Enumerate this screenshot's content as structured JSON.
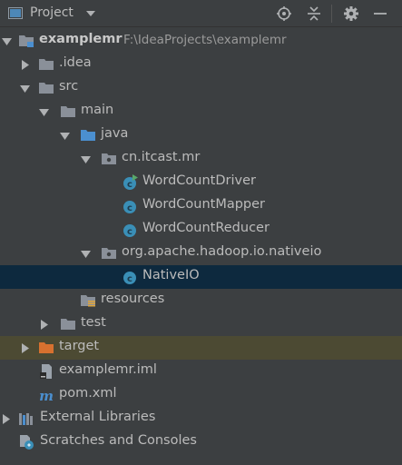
{
  "toolbar": {
    "title": "Project",
    "icons": [
      "project-view-icon",
      "dropdown-icon",
      "locate-icon",
      "collapse-all-icon",
      "settings-icon",
      "minimize-icon"
    ]
  },
  "tree": {
    "root": {
      "label": "examplemr",
      "path": "F:\\IdeaProjects\\examplemr"
    },
    "idea": "idea",
    "idea_prefix": ".",
    "src": "src",
    "main": "main",
    "java": "java",
    "pkg1": "cn.itcast.mr",
    "class1": "WordCountDriver",
    "class2": "WordCountMapper",
    "class3": "WordCountReducer",
    "pkg2": "org.apache.hadoop.io.nativeio",
    "class4": "NativeIO",
    "resources": "resources",
    "test": "test",
    "target": "target",
    "iml": "examplemr.iml",
    "pom": "pom.xml",
    "ext_libs": "External Libraries",
    "scratches": "Scratches and Consoles"
  },
  "colors": {
    "background": "#3c3f41",
    "selection": "#0d293e",
    "excluded": "#4c4a33",
    "folder": "#8a9099",
    "source_folder": "#4b8fcf",
    "target_folder": "#d7712f",
    "class_icon": "#3a8fb7"
  }
}
